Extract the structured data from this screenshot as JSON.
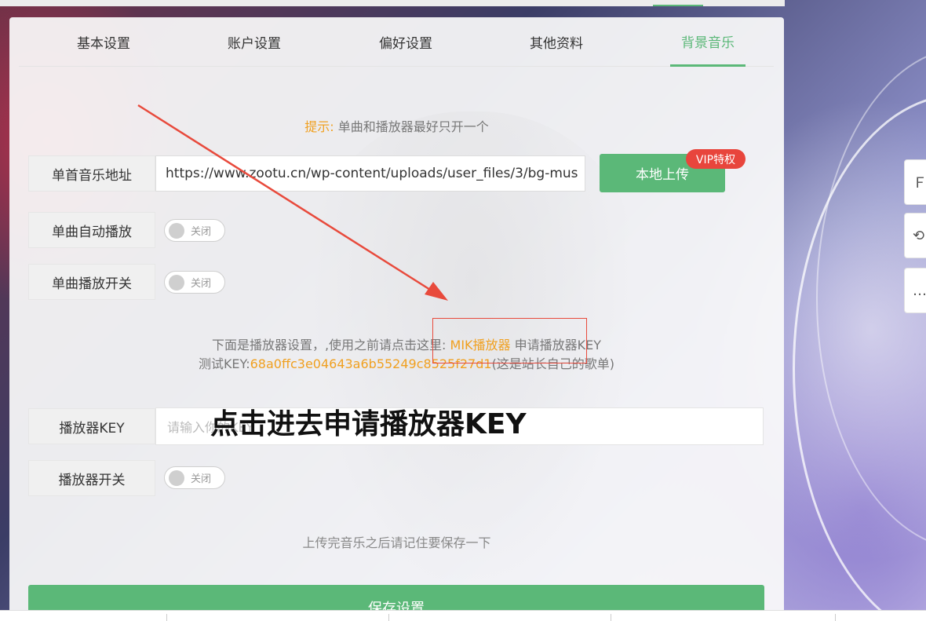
{
  "tabs": [
    {
      "label": "基本设置"
    },
    {
      "label": "账户设置"
    },
    {
      "label": "偏好设置"
    },
    {
      "label": "其他资料"
    },
    {
      "label": "背景音乐",
      "active": true
    }
  ],
  "tip": {
    "prefix": "提示:",
    "text": "单曲和播放器最好只开一个"
  },
  "single_music": {
    "label": "单首音乐地址",
    "url_value": "https://www.zootu.cn/wp-content/uploads/user_files/3/bg-mus",
    "upload_label": "本地上传",
    "vip_badge": "VIP特权"
  },
  "auto_play": {
    "label": "单曲自动播放",
    "toggle_text": "关闭"
  },
  "single_switch": {
    "label": "单曲播放开关",
    "toggle_text": "关闭"
  },
  "player_note": {
    "line1_text": "下面是播放器设置，,使用之前请点击这里:",
    "link": "MIK播放器",
    "line1_suffix": "申请播放器KEY",
    "line2_prefix": "测试KEY:",
    "test_key": "68a0ffc3e04643a6b55249c8525f27d1",
    "line2_suffix": "(这是站长自己的歌单)"
  },
  "player_key": {
    "label": "播放器KEY",
    "placeholder": "请输入你的KEY"
  },
  "player_switch": {
    "label": "播放器开关",
    "toggle_text": "关闭"
  },
  "save_note": "上传完音乐之后请记住要保存一下",
  "save_button": "保存设置",
  "annotation": {
    "overlay_text": "点击进去申请播放器KEY"
  },
  "colors": {
    "accent": "#5bb878",
    "highlight": "#f0a020",
    "vip": "#e8453c",
    "annotation": "#e84a3c"
  },
  "side_icons": [
    "f-icon",
    "refresh-icon",
    "chat-icon"
  ]
}
